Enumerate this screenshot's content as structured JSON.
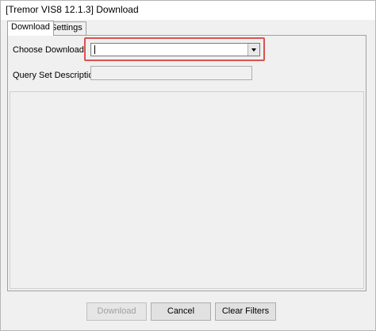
{
  "window": {
    "title": "[Tremor VIS8 12.1.3] Download"
  },
  "tabs": [
    {
      "label": "Download",
      "active": true
    },
    {
      "label": "Settings",
      "active": false
    }
  ],
  "form": {
    "choose_download_label": "Choose Download",
    "choose_download_value": "",
    "query_set_description_label": "Query Set Description",
    "query_set_description_value": ""
  },
  "buttons": {
    "download": "Download",
    "cancel": "Cancel",
    "clear_filters": "Clear Filters"
  },
  "colors": {
    "highlight": "#d9534f",
    "window_bg": "#f0f0f0"
  }
}
